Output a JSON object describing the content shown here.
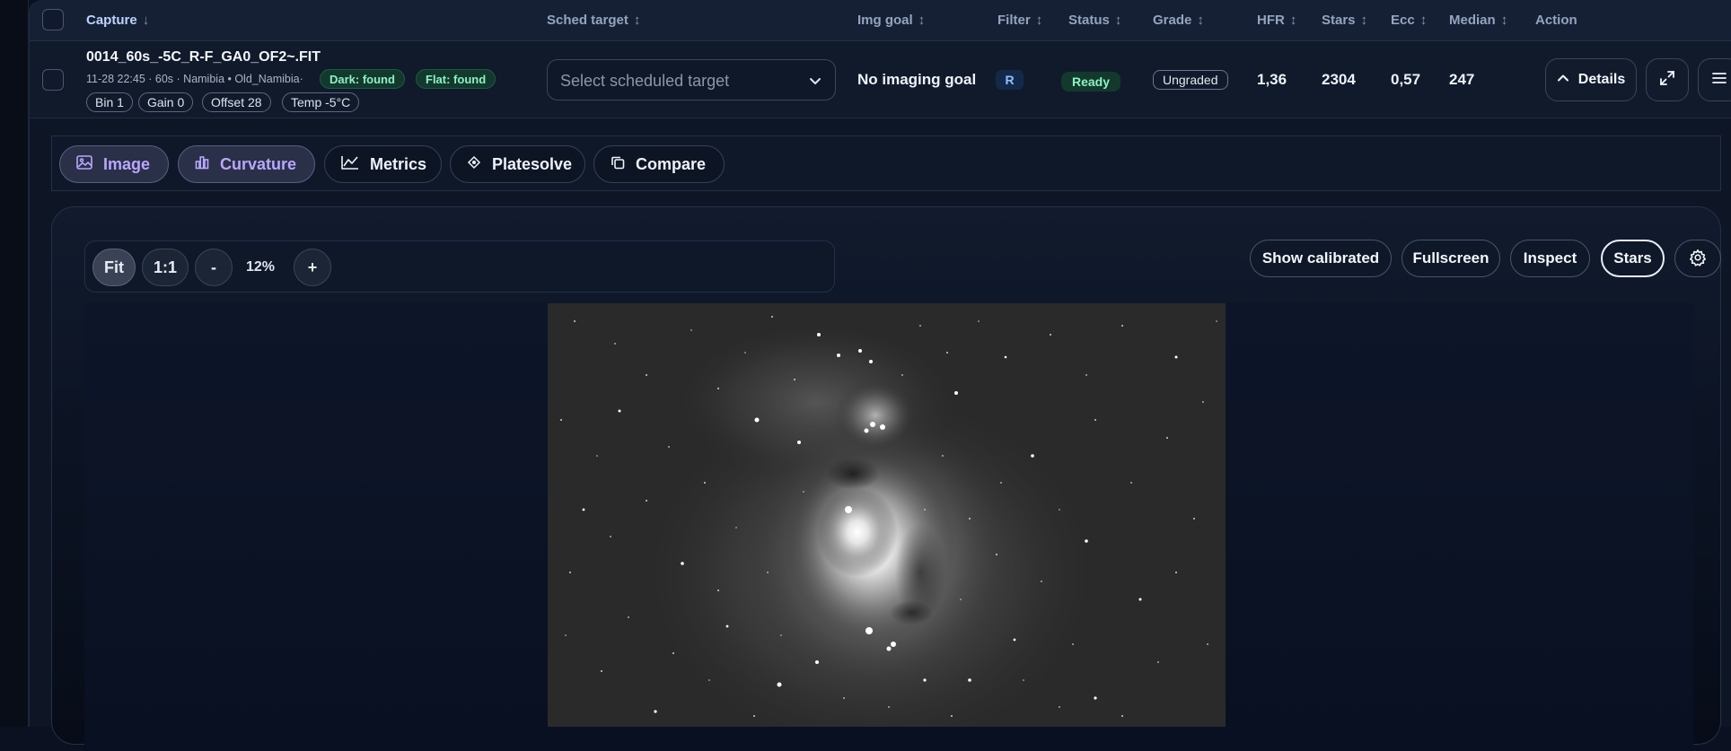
{
  "table": {
    "columns": [
      {
        "key": "capture",
        "label": "Capture",
        "sort": "↓"
      },
      {
        "key": "sched_target",
        "label": "Sched target",
        "sort": "↕"
      },
      {
        "key": "img_goal",
        "label": "Img goal",
        "sort": "↕"
      },
      {
        "key": "filter",
        "label": "Filter",
        "sort": "↕"
      },
      {
        "key": "status",
        "label": "Status",
        "sort": "↕"
      },
      {
        "key": "grade",
        "label": "Grade",
        "sort": "↕"
      },
      {
        "key": "hfr",
        "label": "HFR",
        "sort": "↕"
      },
      {
        "key": "stars",
        "label": "Stars",
        "sort": "↕"
      },
      {
        "key": "ecc",
        "label": "Ecc",
        "sort": "↕"
      },
      {
        "key": "median",
        "label": "Median",
        "sort": "↕"
      },
      {
        "key": "action",
        "label": "Action",
        "sort": ""
      }
    ]
  },
  "row": {
    "filename": "0014_60s_-5C_R-F_GA0_OF2~.FIT",
    "meta": "11-28 22:45 · 60s · Namibia • Old_Namibia·",
    "dark_badge": "Dark: found",
    "flat_badge": "Flat: found",
    "tags": [
      "Bin 1",
      "Gain 0",
      "Offset 28",
      "Temp -5°C"
    ],
    "sched_placeholder": "Select scheduled target",
    "img_goal": "No imaging goal",
    "filter": "R",
    "status": "Ready",
    "grade": "Ungraded",
    "hfr": "1,36",
    "stars": "2304",
    "ecc": "0,57",
    "median": "247",
    "details_label": "Details"
  },
  "tabs": [
    {
      "label": "Image",
      "icon": "image-icon",
      "selected": true
    },
    {
      "label": "Curvature",
      "icon": "curvature-icon",
      "selected": true
    },
    {
      "label": "Metrics",
      "icon": "metrics-icon",
      "selected": false
    },
    {
      "label": "Platesolve",
      "icon": "platesolve-icon",
      "selected": false
    },
    {
      "label": "Compare",
      "icon": "compare-icon",
      "selected": false
    }
  ],
  "viewer": {
    "zoom_fit": "Fit",
    "zoom_1to1": "1:1",
    "zoom_out": "-",
    "zoom_level": "12%",
    "zoom_in": "+",
    "buttons": [
      "Show calibrated",
      "Fullscreen",
      "Inspect",
      "Stars"
    ],
    "active_button": "Stars"
  },
  "colors": {
    "accent_purple": "#b9a6ff",
    "success_green": "#8ff0c2",
    "filter_blue": "#8cc2ff",
    "background": "#0e1626"
  }
}
